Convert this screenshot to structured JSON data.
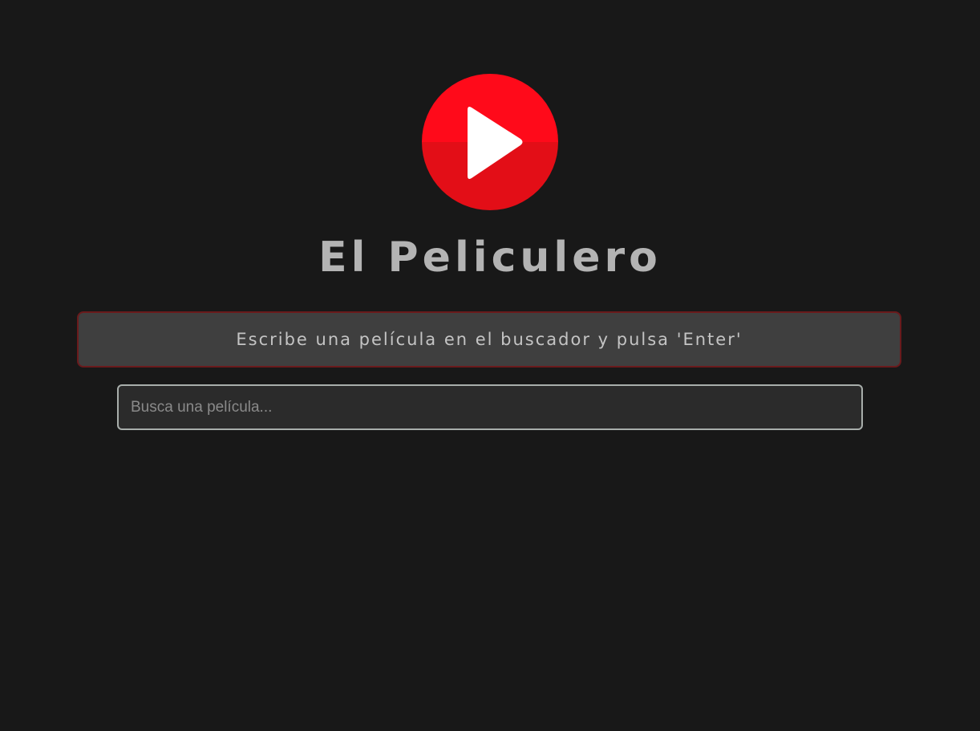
{
  "app": {
    "title": "El Peliculero",
    "logo_icon": "play-icon",
    "accent_color": "#ff0a1a",
    "accent_dark_color": "#e30e17"
  },
  "message": {
    "text": "Escribe una película en el buscador y pulsa 'Enter'"
  },
  "search": {
    "value": "",
    "placeholder": "Busca una película..."
  }
}
